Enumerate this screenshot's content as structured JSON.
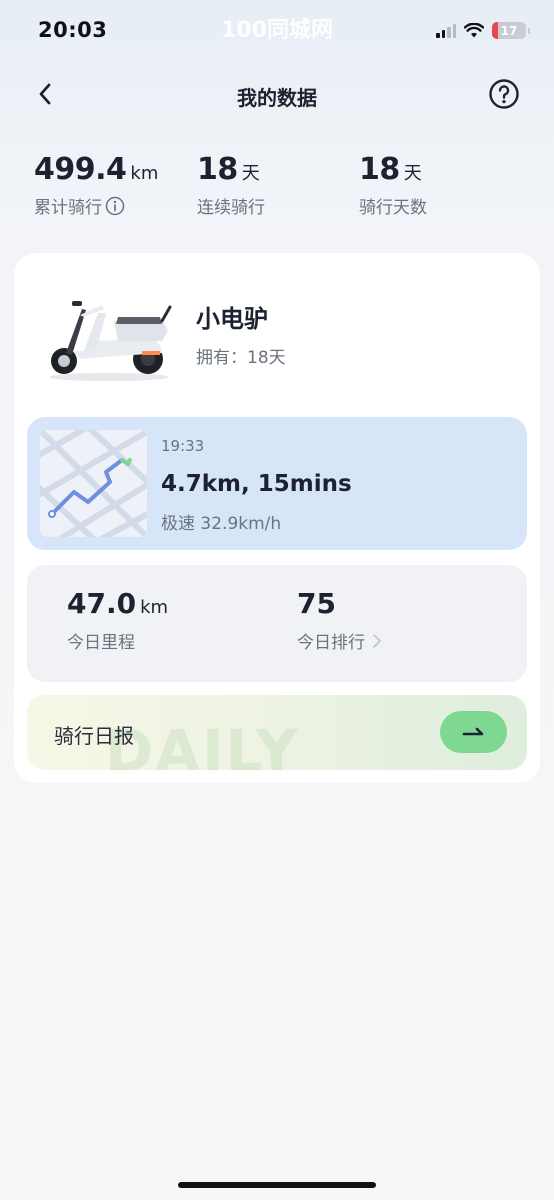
{
  "status_bar": {
    "time": "20:03",
    "watermark": "100同城网",
    "battery": "17",
    "battery_level": 0.17,
    "battery_color": "#e5484d"
  },
  "nav": {
    "title": "我的数据",
    "back_icon": "chevron-left-icon",
    "help_icon": "question-circle-icon"
  },
  "stats": [
    {
      "value": "499.4",
      "unit": "km",
      "label": "累计骑行"
    },
    {
      "value": "18",
      "unit": "天",
      "label": "连续骑行"
    },
    {
      "value": "18",
      "unit": "天",
      "label": "骑行天数"
    }
  ],
  "vehicle": {
    "name": "小电驴",
    "owned": "拥有：18天"
  },
  "ride": {
    "time": "19:33",
    "summary": "4.7km, 15mins",
    "max_speed": "极速 32.9km/h"
  },
  "today": {
    "distance_value": "47.0",
    "distance_unit": "km",
    "distance_label": "今日里程",
    "rank_value": "75",
    "rank_label": "今日排行"
  },
  "daily": {
    "label": "骑行日报",
    "ghost_text": "DAILY",
    "button_color": "#7fd892"
  },
  "colors": {
    "ride_card_bg": "#d6e6f8",
    "accent_green": "#7fd892",
    "text_primary": "#1c2230",
    "text_secondary": "#6b7280"
  }
}
